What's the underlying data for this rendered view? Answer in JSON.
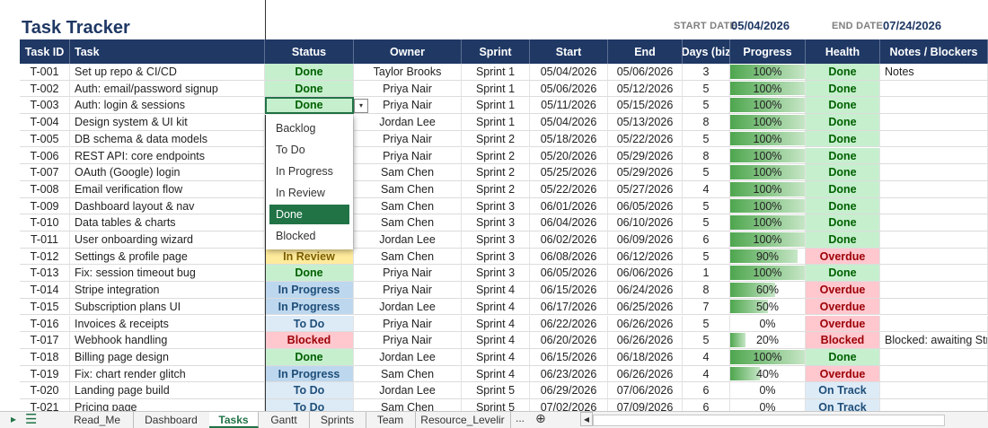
{
  "header": {
    "title": "Task Tracker",
    "start_label": "START DATE",
    "start_value": "05/04/2026",
    "end_label": "END DATE",
    "end_value": "07/24/2026"
  },
  "columns": [
    "Task ID",
    "Task",
    "Status",
    "Owner",
    "Sprint",
    "Start",
    "End",
    "Days (biz",
    "Progress",
    "Health",
    "Notes / Blockers"
  ],
  "status_colors": {
    "Done": {
      "bg": "#c6efce",
      "fg": "#006100"
    },
    "In Review": {
      "bg": "#ffeb9c",
      "fg": "#7f6000"
    },
    "In Progress": {
      "bg": "#bdd7ee",
      "fg": "#1f4e79"
    },
    "To Do": {
      "bg": "#ddebf7",
      "fg": "#1f4e79"
    },
    "Blocked": {
      "bg": "#ffc7ce",
      "fg": "#9c0006"
    },
    "Overdue": {
      "bg": "#ffc7ce",
      "fg": "#9c0006"
    },
    "On Track": {
      "bg": "#ddebf7",
      "fg": "#1f4e79"
    }
  },
  "rows": [
    {
      "id": "T-001",
      "task": "Set up repo & CI/CD",
      "status": "Done",
      "owner": "Taylor Brooks",
      "sprint": "Sprint 1",
      "start": "05/04/2026",
      "end": "05/06/2026",
      "days": "3",
      "progress": "100%",
      "pct": 1.0,
      "health": "Done",
      "notes": "Notes"
    },
    {
      "id": "T-002",
      "task": "Auth: email/password signup",
      "status": "Done",
      "owner": "Priya Nair",
      "sprint": "Sprint 1",
      "start": "05/06/2026",
      "end": "05/12/2026",
      "days": "5",
      "progress": "100%",
      "pct": 1.0,
      "health": "Done",
      "notes": ""
    },
    {
      "id": "T-003",
      "task": "Auth: login & sessions",
      "status": "Done",
      "owner": "Priya Nair",
      "sprint": "Sprint 1",
      "start": "05/11/2026",
      "end": "05/15/2026",
      "days": "5",
      "progress": "100%",
      "pct": 1.0,
      "health": "Done",
      "notes": ""
    },
    {
      "id": "T-004",
      "task": "Design system & UI kit",
      "status": "",
      "owner": "Jordan Lee",
      "sprint": "Sprint 1",
      "start": "05/04/2026",
      "end": "05/13/2026",
      "days": "8",
      "progress": "100%",
      "pct": 1.0,
      "health": "Done",
      "notes": ""
    },
    {
      "id": "T-005",
      "task": "DB schema & data models",
      "status": "",
      "owner": "Priya Nair",
      "sprint": "Sprint 2",
      "start": "05/18/2026",
      "end": "05/22/2026",
      "days": "5",
      "progress": "100%",
      "pct": 1.0,
      "health": "Done",
      "notes": ""
    },
    {
      "id": "T-006",
      "task": "REST API: core endpoints",
      "status": "",
      "owner": "Priya Nair",
      "sprint": "Sprint 2",
      "start": "05/20/2026",
      "end": "05/29/2026",
      "days": "8",
      "progress": "100%",
      "pct": 1.0,
      "health": "Done",
      "notes": ""
    },
    {
      "id": "T-007",
      "task": "OAuth (Google) login",
      "status": "",
      "owner": "Sam Chen",
      "sprint": "Sprint 2",
      "start": "05/25/2026",
      "end": "05/29/2026",
      "days": "5",
      "progress": "100%",
      "pct": 1.0,
      "health": "Done",
      "notes": ""
    },
    {
      "id": "T-008",
      "task": "Email verification flow",
      "status": "",
      "owner": "Sam Chen",
      "sprint": "Sprint 2",
      "start": "05/22/2026",
      "end": "05/27/2026",
      "days": "4",
      "progress": "100%",
      "pct": 1.0,
      "health": "Done",
      "notes": ""
    },
    {
      "id": "T-009",
      "task": "Dashboard layout & nav",
      "status": "",
      "owner": "Sam Chen",
      "sprint": "Sprint 3",
      "start": "06/01/2026",
      "end": "06/05/2026",
      "days": "5",
      "progress": "100%",
      "pct": 1.0,
      "health": "Done",
      "notes": ""
    },
    {
      "id": "T-010",
      "task": "Data tables & charts",
      "status": "",
      "owner": "Sam Chen",
      "sprint": "Sprint 3",
      "start": "06/04/2026",
      "end": "06/10/2026",
      "days": "5",
      "progress": "100%",
      "pct": 1.0,
      "health": "Done",
      "notes": ""
    },
    {
      "id": "T-011",
      "task": "User onboarding wizard",
      "status": "",
      "owner": "Jordan Lee",
      "sprint": "Sprint 3",
      "start": "06/02/2026",
      "end": "06/09/2026",
      "days": "6",
      "progress": "100%",
      "pct": 1.0,
      "health": "Done",
      "notes": ""
    },
    {
      "id": "T-012",
      "task": "Settings & profile page",
      "status": "In Review",
      "owner": "Sam Chen",
      "sprint": "Sprint 3",
      "start": "06/08/2026",
      "end": "06/12/2026",
      "days": "5",
      "progress": "90%",
      "pct": 0.9,
      "health": "Overdue",
      "notes": ""
    },
    {
      "id": "T-013",
      "task": "Fix: session timeout bug",
      "status": "Done",
      "owner": "Priya Nair",
      "sprint": "Sprint 3",
      "start": "06/05/2026",
      "end": "06/06/2026",
      "days": "1",
      "progress": "100%",
      "pct": 1.0,
      "health": "Done",
      "notes": ""
    },
    {
      "id": "T-014",
      "task": "Stripe integration",
      "status": "In Progress",
      "owner": "Priya Nair",
      "sprint": "Sprint 4",
      "start": "06/15/2026",
      "end": "06/24/2026",
      "days": "8",
      "progress": "60%",
      "pct": 0.6,
      "health": "Overdue",
      "notes": ""
    },
    {
      "id": "T-015",
      "task": "Subscription plans UI",
      "status": "In Progress",
      "owner": "Jordan Lee",
      "sprint": "Sprint 4",
      "start": "06/17/2026",
      "end": "06/25/2026",
      "days": "7",
      "progress": "50%",
      "pct": 0.5,
      "health": "Overdue",
      "notes": ""
    },
    {
      "id": "T-016",
      "task": "Invoices & receipts",
      "status": "To Do",
      "owner": "Priya Nair",
      "sprint": "Sprint 4",
      "start": "06/22/2026",
      "end": "06/26/2026",
      "days": "5",
      "progress": "0%",
      "pct": 0.0,
      "health": "Overdue",
      "notes": ""
    },
    {
      "id": "T-017",
      "task": "Webhook handling",
      "status": "Blocked",
      "owner": "Priya Nair",
      "sprint": "Sprint 4",
      "start": "06/20/2026",
      "end": "06/26/2026",
      "days": "5",
      "progress": "20%",
      "pct": 0.2,
      "health": "Blocked",
      "notes": "Blocked: awaiting Str"
    },
    {
      "id": "T-018",
      "task": "Billing page design",
      "status": "Done",
      "owner": "Jordan Lee",
      "sprint": "Sprint 4",
      "start": "06/15/2026",
      "end": "06/18/2026",
      "days": "4",
      "progress": "100%",
      "pct": 1.0,
      "health": "Done",
      "notes": ""
    },
    {
      "id": "T-019",
      "task": "Fix: chart render glitch",
      "status": "In Progress",
      "owner": "Sam Chen",
      "sprint": "Sprint 4",
      "start": "06/23/2026",
      "end": "06/26/2026",
      "days": "4",
      "progress": "40%",
      "pct": 0.4,
      "health": "Overdue",
      "notes": ""
    },
    {
      "id": "T-020",
      "task": "Landing page build",
      "status": "To Do",
      "owner": "Jordan Lee",
      "sprint": "Sprint 5",
      "start": "06/29/2026",
      "end": "07/06/2026",
      "days": "6",
      "progress": "0%",
      "pct": 0.0,
      "health": "On Track",
      "notes": ""
    },
    {
      "id": "T-021",
      "task": "Pricing page",
      "status": "To Do",
      "owner": "Sam Chen",
      "sprint": "Sprint 5",
      "start": "07/02/2026",
      "end": "07/09/2026",
      "days": "6",
      "progress": "0%",
      "pct": 0.0,
      "health": "On Track",
      "notes": ""
    }
  ],
  "dropdown": {
    "options": [
      "Backlog",
      "To Do",
      "In Progress",
      "In Review",
      "Done",
      "Blocked"
    ],
    "selected": "Done",
    "arrow": "▾"
  },
  "sheet_tabs": [
    "Read_Me",
    "Dashboard",
    "Tasks",
    "Gantt",
    "Sprints",
    "Team",
    "Resource_Levelir"
  ],
  "active_tab": "Tasks",
  "tab_controls": {
    "more": "...",
    "add": "⊕",
    "nav_prev": "◂",
    "menu": "☰",
    "play": "▸"
  },
  "icons": {
    "menu": "hamburger-menu-icon",
    "add_sheet": "add-sheet-icon"
  }
}
